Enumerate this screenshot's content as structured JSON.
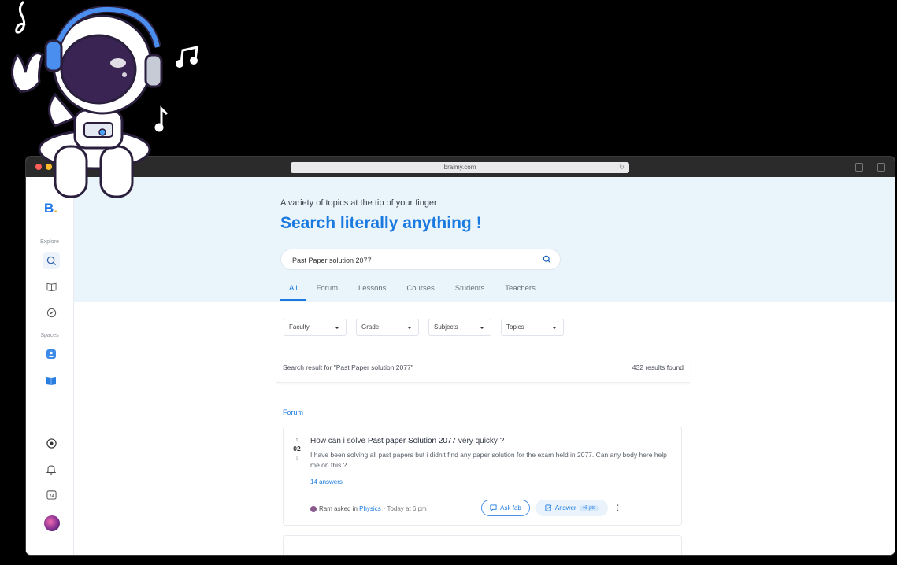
{
  "browser": {
    "url": "braimy.com"
  },
  "sidebar": {
    "logo_letter": "B",
    "logo_dot": ".",
    "explore_label": "Explore",
    "spaces_label": "Spaces",
    "items": [
      {
        "icon": "search-icon"
      },
      {
        "icon": "book-icon"
      },
      {
        "icon": "compass-icon"
      },
      {
        "icon": "people-space-icon"
      },
      {
        "icon": "book-space-icon"
      },
      {
        "icon": "support-icon"
      },
      {
        "icon": "bell-icon"
      },
      {
        "icon": "calendar-24-icon",
        "text": "24"
      }
    ]
  },
  "hero": {
    "subtitle": "A variety of topics at the tip of your finger",
    "title": "Search literally anything !",
    "search_value": "Past Paper solution 2077"
  },
  "tabs": [
    "All",
    "Forum",
    "Lessons",
    "Courses",
    "Students",
    "Teachers"
  ],
  "filters": [
    "Faculty",
    "Grade",
    "Subjects",
    "Topics"
  ],
  "results": {
    "query_text": "Search result for \"Past Paper solution 2077\"",
    "count_text": "432 results found"
  },
  "section_label": "Forum",
  "question": {
    "votes": "02",
    "title_pre": "How can i solve ",
    "title_highlight": "Past paper Solution 2077",
    "title_post": " very quicky ?",
    "body": "I have been solving all past papers but i didn't find any paper solution for the exam held in 2077. Can any body here help me on this ?",
    "answers": "14 answers",
    "author": "Ram",
    "asked_in": " asked in ",
    "space": "Physics",
    "time": "· Today at 6 pm",
    "ask_label": "Ask fab",
    "answer_label": "Answer",
    "points": "+5 pts"
  },
  "colors": {
    "accent": "#1a7ae0",
    "hero_bg": "#eaf4fb",
    "logo_dot": "#f5a623"
  }
}
